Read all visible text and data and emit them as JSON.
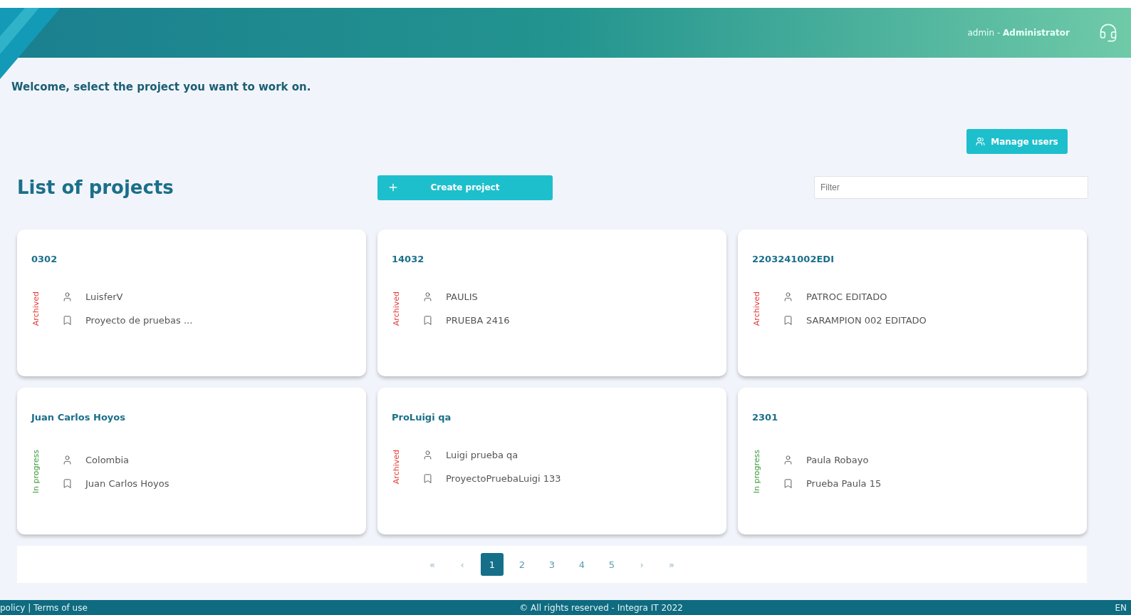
{
  "header": {
    "user": "admin",
    "separator": "-",
    "role": "Administrator"
  },
  "welcome": "Welcome, select the project you want to work on.",
  "manage_users": "Manage users",
  "title": "List of projects",
  "create_project": "Create project",
  "filter": {
    "placeholder": "Filter"
  },
  "projects": [
    {
      "name": "0302",
      "status": "Archived",
      "kind": "archived",
      "owner": "LuisferV",
      "description": "Proyecto de pruebas ..."
    },
    {
      "name": "14032",
      "status": "Archived",
      "kind": "archived",
      "owner": "PAULIS",
      "description": "PRUEBA 2416"
    },
    {
      "name": "2203241002EDI",
      "status": "Archived",
      "kind": "archived",
      "owner": "PATROC EDITADO",
      "description": "SARAMPION 002 EDITADO"
    },
    {
      "name": "Juan Carlos Hoyos",
      "status": "In progress",
      "kind": "in_progress",
      "owner": "Colombia",
      "description": "Juan Carlos Hoyos"
    },
    {
      "name": "ProLuigi qa",
      "status": "Archived",
      "kind": "archived",
      "owner": "Luigi prueba qa",
      "description": "ProyectoPruebaLuigi 133"
    },
    {
      "name": "2301",
      "status": "In progress",
      "kind": "in_progress",
      "owner": "Paula Robayo",
      "description": "Prueba Paula 15"
    }
  ],
  "pagination": [
    {
      "label": "«",
      "kind": "nav",
      "selected": false
    },
    {
      "label": "‹",
      "kind": "nav",
      "selected": false
    },
    {
      "label": "1",
      "kind": "page",
      "selected": true
    },
    {
      "label": "2",
      "kind": "page",
      "selected": false
    },
    {
      "label": "3",
      "kind": "page",
      "selected": false
    },
    {
      "label": "4",
      "kind": "page",
      "selected": false
    },
    {
      "label": "5",
      "kind": "page",
      "selected": false
    },
    {
      "label": "›",
      "kind": "nav",
      "selected": false
    },
    {
      "label": "»",
      "kind": "nav",
      "selected": false
    }
  ],
  "footer": {
    "left": "policy | Terms of use",
    "center": "© All rights reserved - Integra IT 2022",
    "language": "EN"
  }
}
